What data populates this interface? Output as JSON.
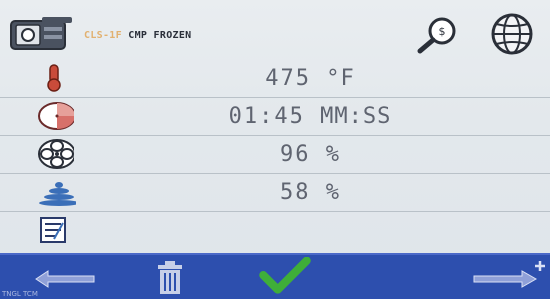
{
  "header": {
    "recipe_code": "CLS-1F",
    "recipe_name": "CMP FROZEN",
    "icons": [
      "recipe-book-icon",
      "search-icon",
      "globe-icon"
    ]
  },
  "rows": [
    {
      "icon": "thermometer-icon",
      "value": "475",
      "unit": "°F"
    },
    {
      "icon": "timer-icon",
      "value": "01:45",
      "unit": "MM:SS"
    },
    {
      "icon": "fan-icon",
      "value": "96",
      "unit": "%"
    },
    {
      "icon": "humidity-icon",
      "value": "58",
      "unit": "%"
    },
    {
      "icon": "notes-icon",
      "value": "",
      "unit": ""
    }
  ],
  "bottom_bar": {
    "icons": [
      "back-arrow-icon",
      "delete-icon",
      "confirm-check-icon",
      "next-add-icon"
    ]
  },
  "footer": {
    "text": "TNGL TCM"
  },
  "colors": {
    "bottom_bar": "#2d4fae",
    "check": "#3fae39",
    "code_text": "#e2b170",
    "value_text": "#5f6470"
  }
}
